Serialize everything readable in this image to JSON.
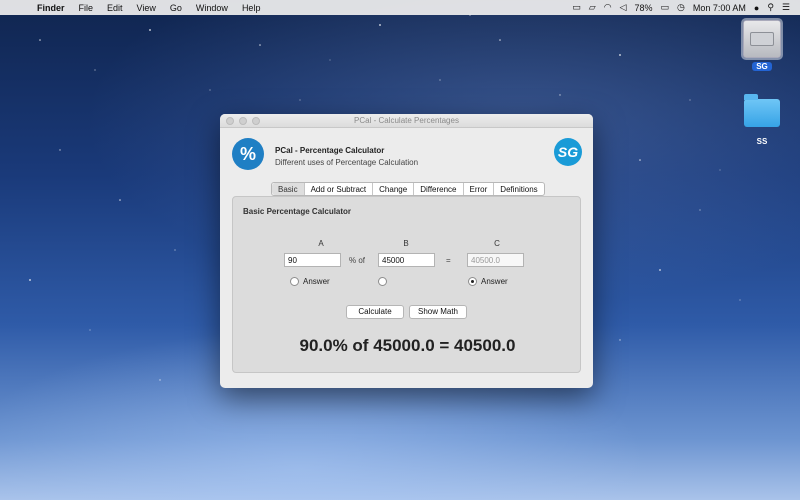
{
  "menubar": {
    "apple_glyph": "",
    "app_name": "Finder",
    "menus": [
      "File",
      "Edit",
      "View",
      "Go",
      "Window",
      "Help"
    ],
    "battery": "78%",
    "clock": "Mon 7:00 AM"
  },
  "desktop": {
    "drive_label": "SG",
    "folder_label": "SS"
  },
  "window": {
    "title": "PCal - Calculate Percentages",
    "app_title": "PCal - Percentage Calculator",
    "app_subtitle": "Different uses of Percentage Calculation",
    "app_icon_glyph": "%",
    "brand_text": "SG",
    "tabs": [
      "Basic",
      "Add or Subtract",
      "Change",
      "Difference",
      "Error",
      "Definitions"
    ],
    "active_tab": "Basic",
    "panel": {
      "title": "Basic Percentage Calculator",
      "col_a": "A",
      "col_b": "B",
      "col_c": "C",
      "value_a": "90",
      "value_b": "45000",
      "value_c": "40500.0",
      "percent_of": "% of",
      "equals": "=",
      "answer_a": "Answer",
      "answer_c": "Answer",
      "calculate_label": "Calculate",
      "show_math_label": "Show Math",
      "result": "90.0% of 45000.0 = 40500.0"
    }
  }
}
